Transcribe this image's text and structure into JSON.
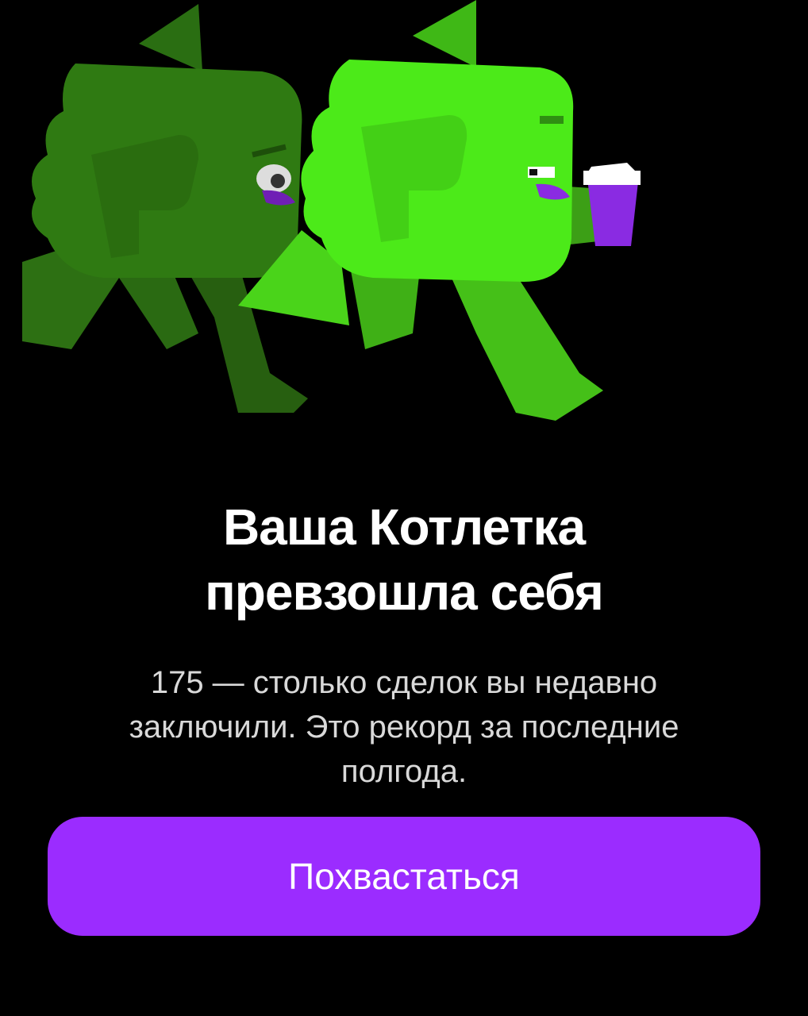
{
  "screen": {
    "title_line1": "Ваша Котлетка",
    "title_line2": "превзошла себя",
    "description": "175 — столько сделок вы недавно заключили. Это рекорд за последние полгода.",
    "cta_label": "Похвастаться"
  },
  "colors": {
    "background": "#000000",
    "accent": "#9b2cff",
    "mascot_dark": "#2f7a12",
    "mascot_light": "#4ce619",
    "mascot_purple": "#8a2be2"
  },
  "illustration": {
    "icon": "two-green-mascots-running-icon"
  }
}
